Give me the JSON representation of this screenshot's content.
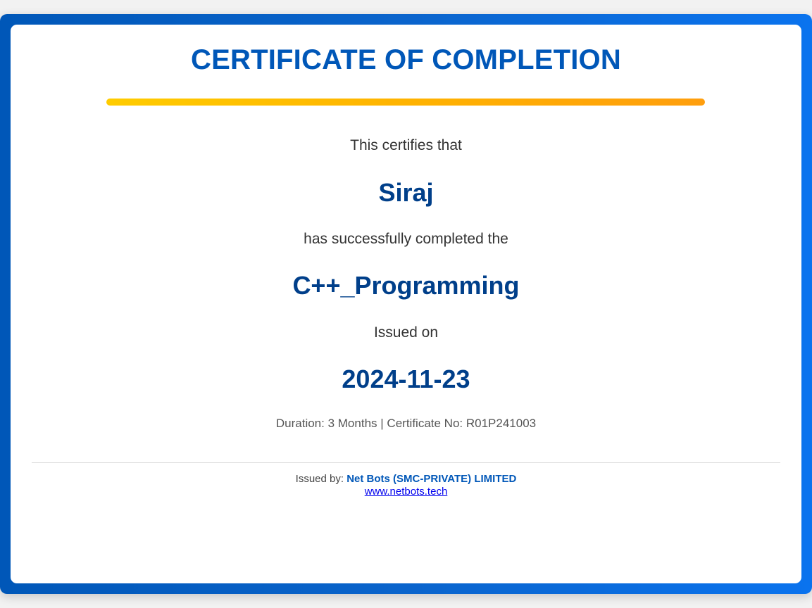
{
  "certificate": {
    "title": "CERTIFICATE OF COMPLETION",
    "intro_text": "This certifies that",
    "recipient_name": "Siraj",
    "completed_text": "has successfully completed the",
    "course_name": "C++_Programming",
    "issued_label": "Issued on",
    "issue_date": "2024-11-23",
    "duration_label": "Duration:",
    "duration_value": "3 Months",
    "separator": "|",
    "certificate_no_label": "Certificate No:",
    "certificate_no_value": "R01P241003"
  },
  "footer": {
    "issued_by_label": "Issued by:",
    "issuer_name": "Net Bots (SMC-PRIVATE) LIMITED",
    "website": "www.netbots.tech"
  },
  "colors": {
    "frame_blue": "#0057b8",
    "heading_blue": "#003f8a",
    "accent_start": "#ffcc00",
    "accent_end": "#ff9e0d",
    "link": "#0000ee"
  }
}
